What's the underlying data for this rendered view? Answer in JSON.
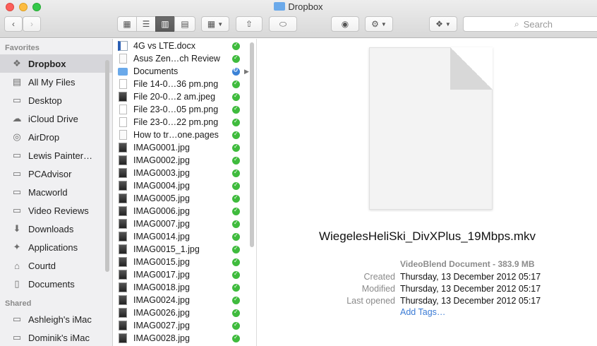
{
  "window": {
    "title": "Dropbox"
  },
  "toolbar": {
    "search_placeholder": "Search"
  },
  "sidebar": {
    "favorites_header": "Favorites",
    "favorites": [
      {
        "label": "Dropbox",
        "icon": "dropbox-icon",
        "active": true
      },
      {
        "label": "All My Files",
        "icon": "all-files-icon"
      },
      {
        "label": "Desktop",
        "icon": "desktop-icon"
      },
      {
        "label": "iCloud Drive",
        "icon": "cloud-icon"
      },
      {
        "label": "AirDrop",
        "icon": "airdrop-icon"
      },
      {
        "label": "Lewis Painter…",
        "icon": "folder-icon"
      },
      {
        "label": "PCAdvisor",
        "icon": "folder-icon"
      },
      {
        "label": "Macworld",
        "icon": "folder-icon"
      },
      {
        "label": "Video Reviews",
        "icon": "folder-icon"
      },
      {
        "label": "Downloads",
        "icon": "downloads-icon"
      },
      {
        "label": "Applications",
        "icon": "applications-icon"
      },
      {
        "label": "Courtd",
        "icon": "home-icon"
      },
      {
        "label": "Documents",
        "icon": "documents-icon"
      }
    ],
    "shared_header": "Shared",
    "shared": [
      {
        "label": "Ashleigh's iMac",
        "icon": "imac-icon"
      },
      {
        "label": "Dominik's iMac",
        "icon": "imac-icon"
      }
    ]
  },
  "files": [
    {
      "name": "4G vs LTE.docx",
      "type": "word",
      "sync": "done"
    },
    {
      "name": "Asus Zen…ch Review",
      "type": "doc",
      "sync": "done"
    },
    {
      "name": "Documents",
      "type": "folder",
      "sync": "syncing"
    },
    {
      "name": "File 14-0…36 pm.png",
      "type": "blank",
      "sync": "done"
    },
    {
      "name": "File 20-0…2 am.jpeg",
      "type": "image",
      "sync": "done"
    },
    {
      "name": "File 23-0…05 pm.png",
      "type": "blank",
      "sync": "done"
    },
    {
      "name": "File 23-0…22 pm.png",
      "type": "blank",
      "sync": "done"
    },
    {
      "name": "How to tr…one.pages",
      "type": "doc",
      "sync": "done"
    },
    {
      "name": "IMAG0001.jpg",
      "type": "image",
      "sync": "done"
    },
    {
      "name": "IMAG0002.jpg",
      "type": "image",
      "sync": "done"
    },
    {
      "name": "IMAG0003.jpg",
      "type": "image",
      "sync": "done"
    },
    {
      "name": "IMAG0004.jpg",
      "type": "image",
      "sync": "done"
    },
    {
      "name": "IMAG0005.jpg",
      "type": "image",
      "sync": "done"
    },
    {
      "name": "IMAG0006.jpg",
      "type": "image",
      "sync": "done"
    },
    {
      "name": "IMAG0007.jpg",
      "type": "image",
      "sync": "done"
    },
    {
      "name": "IMAG0014.jpg",
      "type": "image",
      "sync": "done"
    },
    {
      "name": "IMAG0015_1.jpg",
      "type": "image",
      "sync": "done"
    },
    {
      "name": "IMAG0015.jpg",
      "type": "image",
      "sync": "done"
    },
    {
      "name": "IMAG0017.jpg",
      "type": "image",
      "sync": "done"
    },
    {
      "name": "IMAG0018.jpg",
      "type": "image",
      "sync": "done"
    },
    {
      "name": "IMAG0024.jpg",
      "type": "image",
      "sync": "done"
    },
    {
      "name": "IMAG0026.jpg",
      "type": "image",
      "sync": "done"
    },
    {
      "name": "IMAG0027.jpg",
      "type": "image",
      "sync": "done"
    },
    {
      "name": "IMAG0028.jpg",
      "type": "image",
      "sync": "done"
    }
  ],
  "preview": {
    "filename": "WiegelesHeliSki_DivXPlus_19Mbps.mkv",
    "kind": "VideoBlend Document - 383.9 MB",
    "created_label": "Created",
    "created": "Thursday, 13 December 2012 05:17",
    "modified_label": "Modified",
    "modified": "Thursday, 13 December 2012 05:17",
    "opened_label": "Last opened",
    "opened": "Thursday, 13 December 2012 05:17",
    "add_tags": "Add Tags…"
  }
}
